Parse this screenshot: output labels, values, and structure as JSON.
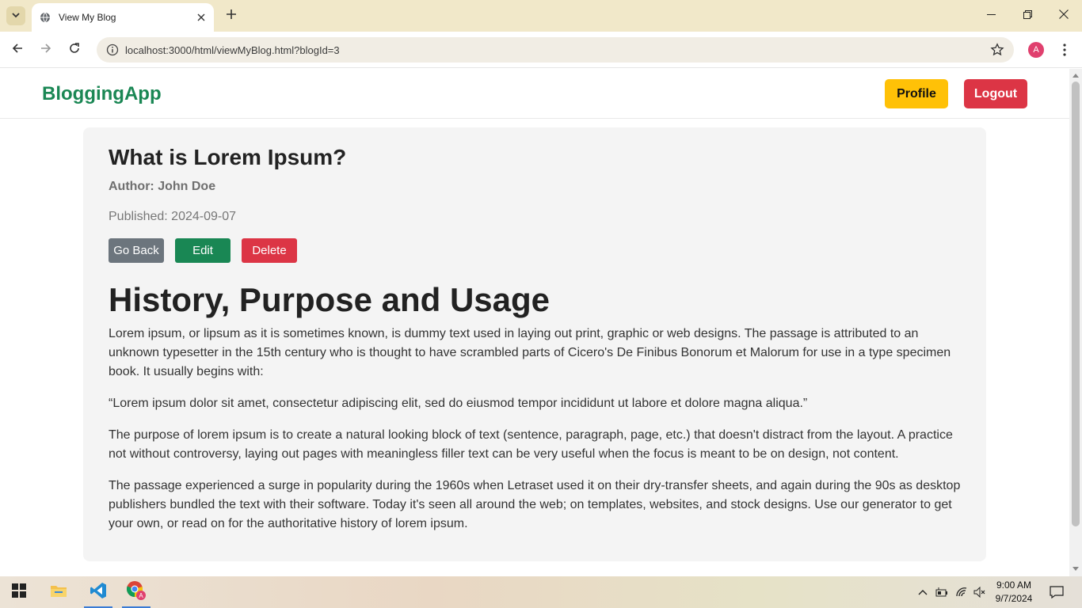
{
  "browser": {
    "tab_title": "View My Blog",
    "url": "localhost:3000/html/viewMyBlog.html?blogId=3",
    "profile_initial": "A"
  },
  "site": {
    "brand": "BloggingApp",
    "profile_label": "Profile",
    "logout_label": "Logout"
  },
  "post": {
    "title": "What is Lorem Ipsum?",
    "author": "Author: John Doe",
    "published": "Published: 2024-09-07",
    "back_label": "Go Back",
    "edit_label": "Edit",
    "delete_label": "Delete",
    "heading": "History, Purpose and Usage",
    "paragraphs": [
      "Lorem ipsum, or lipsum as it is sometimes known, is dummy text used in laying out print, graphic or web designs. The passage is attributed to an unknown typesetter in the 15th century who is thought to have scrambled parts of Cicero's De Finibus Bonorum et Malorum for use in a type specimen book. It usually begins with:",
      "“Lorem ipsum dolor sit amet, consectetur adipiscing elit, sed do eiusmod tempor incididunt ut labore et dolore magna aliqua.”",
      "The purpose of lorem ipsum is to create a natural looking block of text (sentence, paragraph, page, etc.) that doesn't distract from the layout. A practice not without controversy, laying out pages with meaningless filler text can be very useful when the focus is meant to be on design, not content.",
      "The passage experienced a surge in popularity during the 1960s when Letraset used it on their dry-transfer sheets, and again during the 90s as desktop publishers bundled the text with their software. Today it's seen all around the web; on templates, websites, and stock designs. Use our generator to get your own, or read on for the authoritative history of lorem ipsum."
    ]
  },
  "taskbar": {
    "time": "9:00 AM",
    "date": "9/7/2024"
  },
  "colors": {
    "brand": "#1a8754",
    "profile_button": "#ffc107",
    "danger": "#dc3545",
    "secondary": "#6c757d",
    "success": "#198754"
  }
}
